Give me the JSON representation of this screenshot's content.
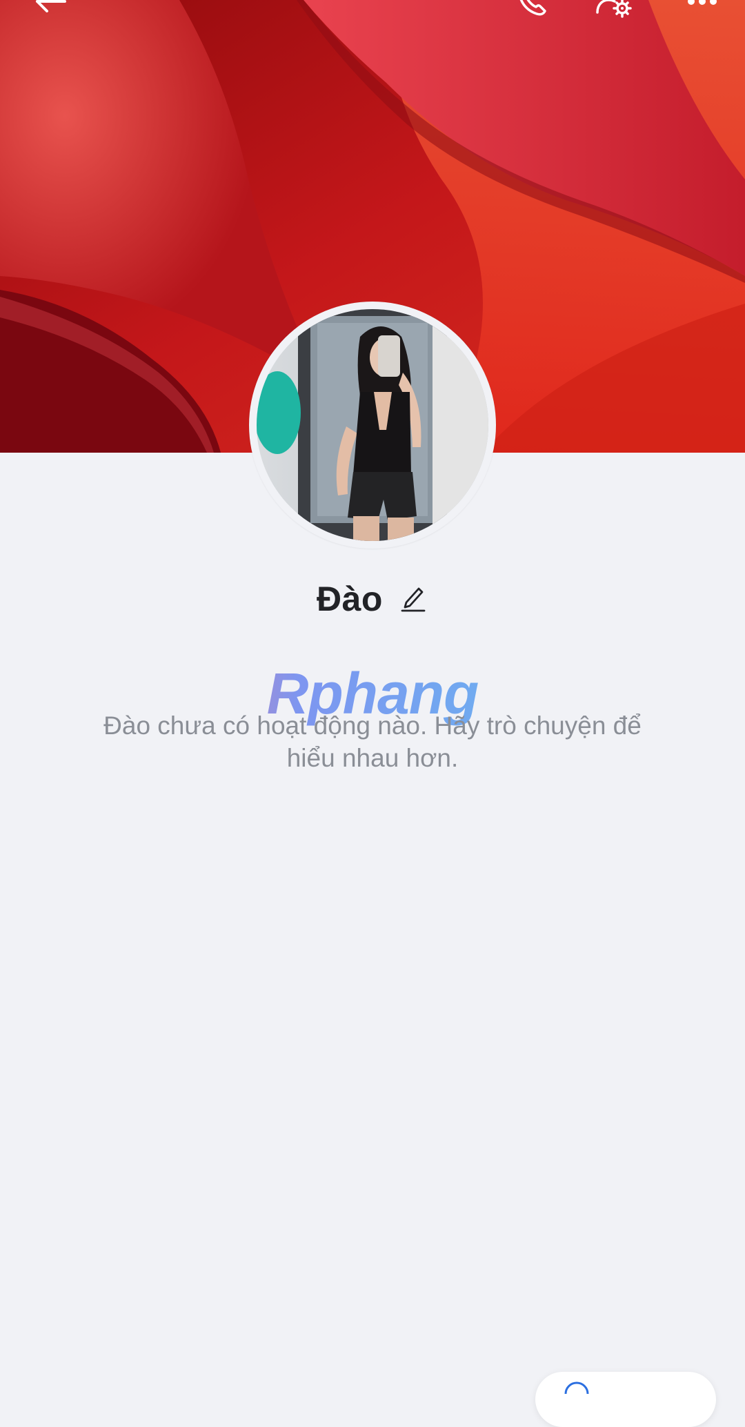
{
  "profile": {
    "name": "Đào",
    "empty_message": "Đào chưa có hoạt động nào. Hãy trò chuyện để hiểu nhau hơn."
  },
  "watermark": {
    "text": "Rphang"
  },
  "toolbar": {
    "icons": [
      "back-arrow-icon",
      "phone-icon",
      "user-settings-icon",
      "more-options-icon"
    ]
  },
  "colors": {
    "cover": "#c41a1c",
    "background": "#f1f2f6",
    "name_text": "#222327",
    "message_text": "#8a8e96"
  }
}
